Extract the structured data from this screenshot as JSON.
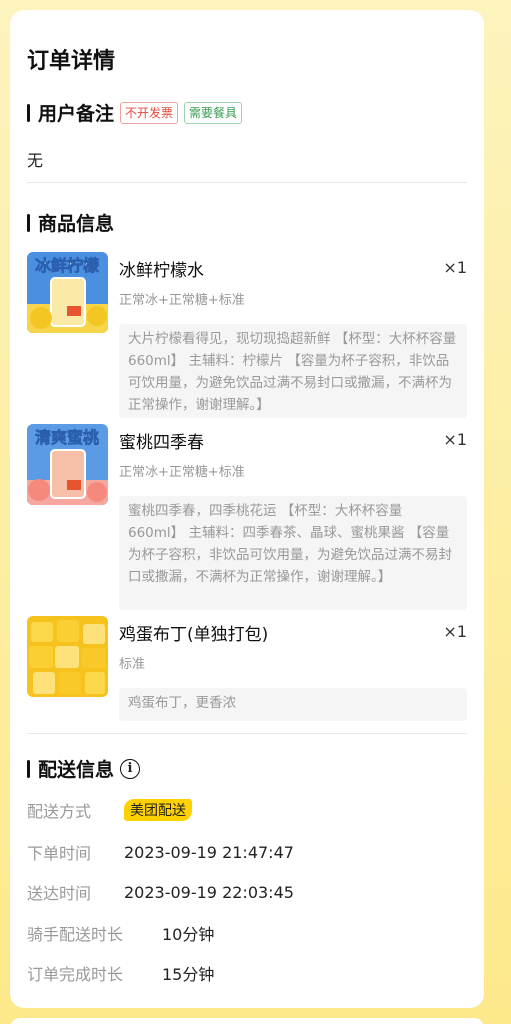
{
  "page": {
    "title": "订单详情"
  },
  "remark_section": {
    "title": "用户备注",
    "tags": [
      "不开发票",
      "需要餐具"
    ],
    "content": "无"
  },
  "goods_section": {
    "title": "商品信息",
    "items": [
      {
        "name": "冰鲜柠檬水",
        "qty": "×1",
        "spec": "正常冰+正常糖+标准",
        "desc": "大片柠檬看得见，现切现捣超新鲜 【杯型：大杯杯容量660ml】 主辅料：柠檬片 【容量为杯子容积，非饮品可饮用量，为避免饮品过满不易封口或撒漏，不满杯为正常操作，谢谢理解。】",
        "thumb_text": "冰鲜柠檬",
        "thumb_icon": "lemon-drink-icon"
      },
      {
        "name": "蜜桃四季春",
        "qty": "×1",
        "spec": "正常冰+正常糖+标准",
        "desc": "蜜桃四季春，四季桃花运 【杯型：大杯杯容量660ml】 主辅料：四季春茶、晶球、蜜桃果酱 【容量为杯子容积，非饮品可饮用量，为避免饮品过满不易封口或撒漏，不满杯为正常操作，谢谢理解。】",
        "thumb_text": "清爽蜜桃",
        "thumb_icon": "peach-drink-icon"
      },
      {
        "name": "鸡蛋布丁(单独打包)",
        "qty": "×1",
        "spec": "标准",
        "desc": "鸡蛋布丁，更香浓",
        "thumb_icon": "egg-pudding-icon"
      }
    ]
  },
  "delivery_section": {
    "title": "配送信息",
    "rows": [
      {
        "label": "配送方式",
        "value": "美团配送"
      },
      {
        "label": "下单时间",
        "value": "2023-09-19 21:47:47"
      },
      {
        "label": "送达时间",
        "value": "2023-09-19 22:03:45"
      },
      {
        "label": "骑手配送时长",
        "value": "10分钟"
      },
      {
        "label": "订单完成时长",
        "value": "15分钟"
      }
    ]
  },
  "colors": {
    "background_top": "#fdf3bd",
    "background_bottom": "#fde98a",
    "tag_red": "#e04b3c",
    "tag_green": "#3a9b55",
    "delivery_badge": "#ffd100"
  }
}
